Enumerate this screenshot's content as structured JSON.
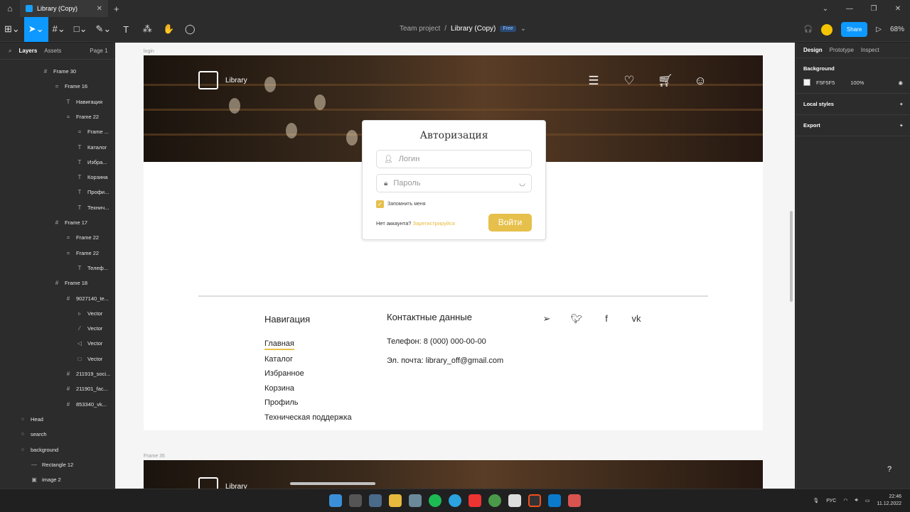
{
  "window": {
    "tab_title": "Library (Copy)"
  },
  "toolbar": {
    "project": "Team project",
    "separator": "/",
    "file": "Library (Copy)",
    "plan_badge": "Free",
    "share": "Share",
    "zoom": "68%"
  },
  "left_panel": {
    "tabs": [
      "Layers",
      "Assets"
    ],
    "page": "Page 1",
    "layers": [
      {
        "label": "Frame 30",
        "indent": 60,
        "icon": "#"
      },
      {
        "label": "Frame 16",
        "indent": 76,
        "icon": "="
      },
      {
        "label": "Навигация",
        "indent": 92,
        "icon": "T"
      },
      {
        "label": "Frame 22",
        "indent": 92,
        "icon": "="
      },
      {
        "label": "Frame ...",
        "indent": 108,
        "icon": "="
      },
      {
        "label": "Каталог",
        "indent": 108,
        "icon": "T"
      },
      {
        "label": "Избра...",
        "indent": 108,
        "icon": "T"
      },
      {
        "label": "Корзина",
        "indent": 108,
        "icon": "T"
      },
      {
        "label": "Профи...",
        "indent": 108,
        "icon": "T"
      },
      {
        "label": "Технич...",
        "indent": 108,
        "icon": "T"
      },
      {
        "label": "Frame 17",
        "indent": 76,
        "icon": "#"
      },
      {
        "label": "Frame 22",
        "indent": 92,
        "icon": "="
      },
      {
        "label": "Frame 22",
        "indent": 92,
        "icon": "="
      },
      {
        "label": "Телеф...",
        "indent": 108,
        "icon": "T"
      },
      {
        "label": "Frame 18",
        "indent": 76,
        "icon": "#"
      },
      {
        "label": "9027140_te...",
        "indent": 92,
        "icon": "#"
      },
      {
        "label": "Vector",
        "indent": 108,
        "icon": "▹"
      },
      {
        "label": "Vector",
        "indent": 108,
        "icon": "⁄"
      },
      {
        "label": "Vector",
        "indent": 108,
        "icon": "◁"
      },
      {
        "label": "Vector",
        "indent": 108,
        "icon": "□"
      },
      {
        "label": "211919_soci...",
        "indent": 92,
        "icon": "#"
      },
      {
        "label": "211901_fac...",
        "indent": 92,
        "icon": "#"
      },
      {
        "label": "853340_vk...",
        "indent": 92,
        "icon": "#"
      },
      {
        "label": "Head",
        "indent": 28,
        "icon": "⁘"
      },
      {
        "label": "search",
        "indent": 28,
        "icon": "⁘"
      },
      {
        "label": "background",
        "indent": 28,
        "icon": "⁘"
      },
      {
        "label": "Rectangle 12",
        "indent": 44,
        "icon": "—"
      },
      {
        "label": "image 2",
        "indent": 44,
        "icon": "▣"
      }
    ]
  },
  "right_panel": {
    "tabs": [
      "Design",
      "Prototype",
      "Inspect"
    ],
    "background_title": "Background",
    "bg_hex": "F5F5F5",
    "bg_opacity": "100%",
    "local_styles": "Local styles",
    "export": "Export"
  },
  "canvas": {
    "frame_label": "login",
    "frame2_label": "Frame 35",
    "logo_text": "Library",
    "logo_text_2": "Library",
    "auth": {
      "title": "Авторизация",
      "login_placeholder": "Логин",
      "password_placeholder": "Пароль",
      "remember": "Запомнить меня",
      "no_account": "Нет аккаунта?",
      "register": "Зарегистрируйся",
      "submit": "Войти"
    },
    "footer": {
      "nav_title": "Навигация",
      "nav_links": [
        "Главная",
        "Каталог",
        "Избранное",
        "Корзина",
        "Профиль",
        "Техническая поддержка"
      ],
      "contact_title": "Контактные данные",
      "phone": "Телефон: 8 (000) 000-00-00",
      "email": "Эл. почта: library_off@gmail.com"
    }
  },
  "taskbar": {
    "lang": "РУС",
    "time": "22:46",
    "date": "11.12.2022"
  }
}
